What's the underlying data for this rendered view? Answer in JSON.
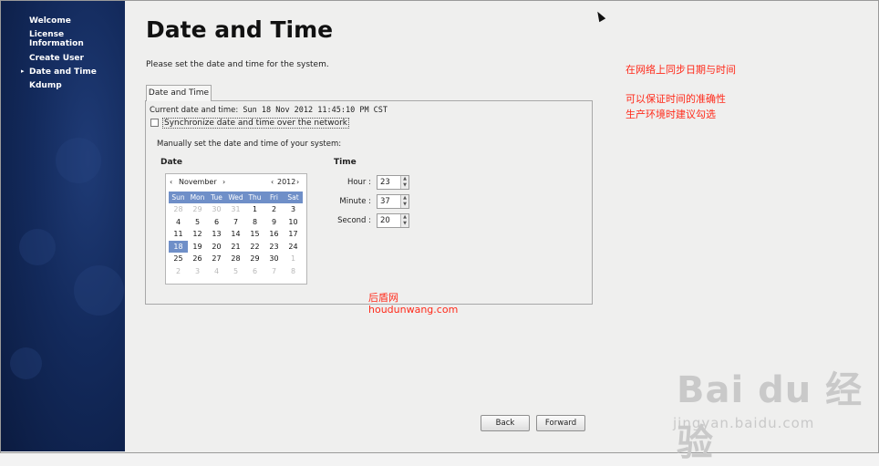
{
  "sidebar": {
    "items": [
      {
        "label": "Welcome"
      },
      {
        "label": "License Information"
      },
      {
        "label": "Create User"
      },
      {
        "label": "Date and Time",
        "current": true
      },
      {
        "label": "Kdump"
      }
    ]
  },
  "page": {
    "title": "Date and Time",
    "subtitle": "Please set the date and time for the system."
  },
  "tab": {
    "label": "Date and Time"
  },
  "current": {
    "label": "Current date and time:",
    "value": "Sun 18 Nov 2012 11:45:10 PM CST"
  },
  "sync": {
    "label": "Synchronize date and time over the network",
    "checked": false
  },
  "manual_label": "Manually set the date and time of your system:",
  "date_section": {
    "heading": "Date"
  },
  "time_section": {
    "heading": "Time"
  },
  "calendar": {
    "month": "November",
    "year": "2012",
    "prev": "‹",
    "next": "›",
    "weekdays": [
      "Sun",
      "Mon",
      "Tue",
      "Wed",
      "Thu",
      "Fri",
      "Sat"
    ],
    "weeks": [
      [
        "28",
        "29",
        "30",
        "31",
        "1",
        "2",
        "3"
      ],
      [
        "4",
        "5",
        "6",
        "7",
        "8",
        "9",
        "10"
      ],
      [
        "11",
        "12",
        "13",
        "14",
        "15",
        "16",
        "17"
      ],
      [
        "18",
        "19",
        "20",
        "21",
        "22",
        "23",
        "24"
      ],
      [
        "25",
        "26",
        "27",
        "28",
        "29",
        "30",
        "1"
      ],
      [
        "2",
        "3",
        "4",
        "5",
        "6",
        "7",
        "8"
      ]
    ],
    "selected_day": "18"
  },
  "time": {
    "hour_label": "Hour :",
    "hour": "23",
    "minute_label": "Minute :",
    "minute": "37",
    "second_label": "Second :",
    "second": "20"
  },
  "buttons": {
    "back": "Back",
    "forward": "Forward"
  },
  "annotations": {
    "line1": "在网络上同步日期与时间",
    "line2": "可以保证时间的准确性",
    "line3": "生产环境时建议勾选",
    "site_cn": "后盾网",
    "site_url": "houdunwang.com"
  },
  "watermark": {
    "brand": "Bai du 经验",
    "url": "jingyan.baidu.com"
  },
  "colors": {
    "sidebar": "#132a5c",
    "accent": "#6f8fc8",
    "annotation": "#ff2a1a"
  }
}
